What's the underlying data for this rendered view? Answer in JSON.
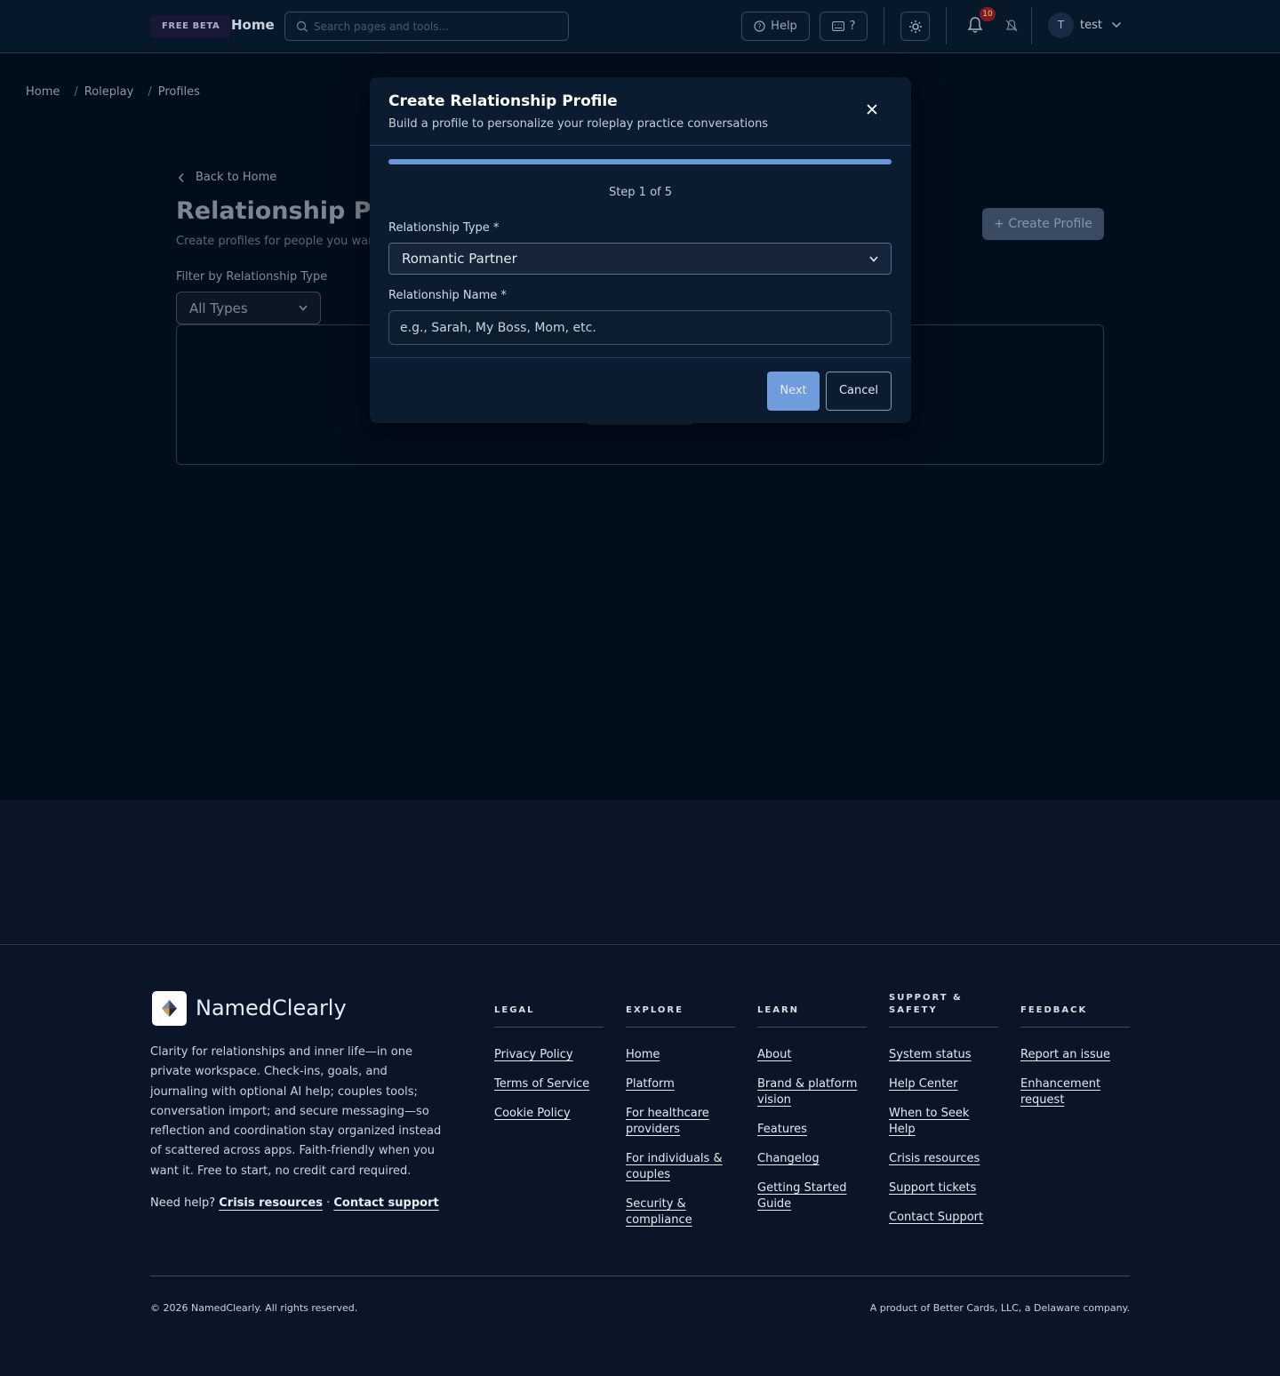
{
  "header": {
    "beta_badge": "FREE BETA",
    "home_link": "Home",
    "search_placeholder": "Search pages and tools...",
    "help_label": "Help",
    "shortcut_label": "?",
    "notification_count": "10",
    "user_initial": "T",
    "user_name": "test"
  },
  "breadcrumb": [
    "Home",
    "Roleplay",
    "Profiles"
  ],
  "page": {
    "back_label": "Back to Home",
    "title": "Relationship Profiles",
    "subtitle": "Create profiles for people you want to practice conversations with",
    "create_button": "+ Create Profile",
    "filter_label": "Filter by Relationship Type",
    "filter_value": "All Types"
  },
  "modal": {
    "title": "Create Relationship Profile",
    "subtitle": "Build a profile to personalize your roleplay practice conversations",
    "progress": 0.2,
    "step_text": "Step 1 of 5",
    "type_label": "Relationship Type *",
    "type_value": "Romantic Partner",
    "name_label": "Relationship Name *",
    "name_placeholder": "e.g., Sarah, My Boss, Mom, etc.",
    "next_label": "Next",
    "cancel_label": "Cancel"
  },
  "footer": {
    "brand": "NamedClearly",
    "description": "Clarity for relationships and inner life—in one private workspace. Check-ins, goals, and journaling with optional AI help; couples tools; conversation import; and secure messaging—so reflection and coordination stay organized instead of scattered across apps. Faith-friendly when you want it. Free to start, no credit card required.",
    "need_help": "Need help?",
    "crisis_link": "Crisis resources",
    "separator": "·",
    "contact_link": "Contact support",
    "columns": [
      {
        "heading": "LEGAL",
        "links": [
          "Privacy Policy",
          "Terms of Service",
          "Cookie Policy"
        ]
      },
      {
        "heading": "EXPLORE",
        "links": [
          "Home",
          "Platform",
          "For healthcare providers",
          "For individuals & couples",
          "Security & compliance"
        ]
      },
      {
        "heading": "LEARN",
        "links": [
          "About",
          "Brand & platform vision",
          "Features",
          "Changelog",
          "Getting Started Guide"
        ]
      },
      {
        "heading": "SUPPORT & SAFETY",
        "links": [
          "System status",
          "Help Center",
          "When to Seek Help",
          "Crisis resources",
          "Support tickets",
          "Contact Support"
        ]
      },
      {
        "heading": "FEEDBACK",
        "links": [
          "Report an issue",
          "Enhancement request"
        ]
      }
    ],
    "copyright": "© 2026 NamedClearly. All rights reserved.",
    "product_note": "A product of Better Cards, LLC, a Delaware company."
  }
}
